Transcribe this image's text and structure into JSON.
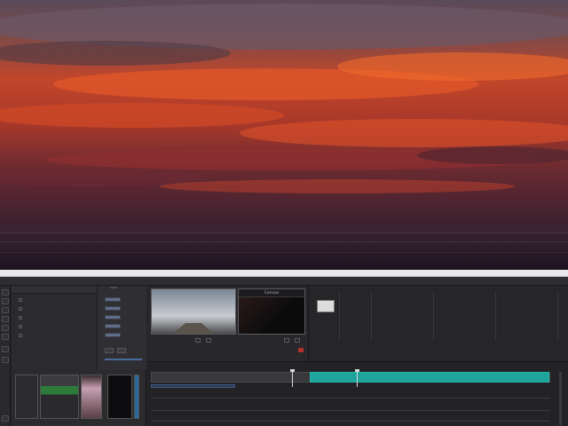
{
  "window": {
    "title": "",
    "menu": []
  },
  "left_panel": {
    "tabs": [],
    "layers": [],
    "swatches": {
      "title": "",
      "rows": []
    },
    "controls": []
  },
  "viewer": {
    "program_label": "Canvas"
  },
  "project": {
    "header": []
  },
  "timeline": {
    "toolbar": []
  },
  "colors": {
    "accent": "#1fa39a",
    "record": "#b0302a",
    "panel": "#252528"
  }
}
